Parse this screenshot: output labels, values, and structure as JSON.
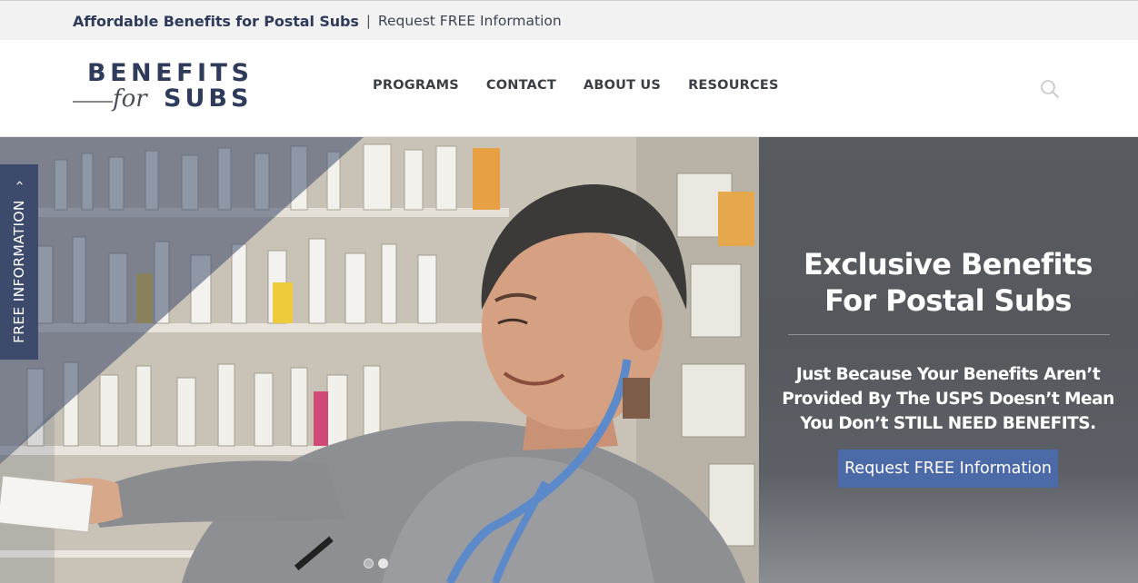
{
  "topbar": {
    "title": "Affordable Benefits for Postal Subs",
    "separator": "|",
    "link": "Request FREE Information"
  },
  "logo": {
    "top": "BENEFITS",
    "for": "for",
    "bottom": "SUBS"
  },
  "nav": {
    "items": [
      {
        "label": "PROGRAMS"
      },
      {
        "label": "CONTACT"
      },
      {
        "label": "ABOUT US"
      },
      {
        "label": "RESOURCES"
      }
    ],
    "search_icon": "search-icon"
  },
  "side_tab": {
    "label": "FREE INFORMATION",
    "arrow": "›"
  },
  "hero": {
    "title": "Exclusive Benefits For Postal Subs",
    "subtitle": "Just Because Your Benefits Aren’t Provided By The USPS Doesn’t Mean You Don’t STILL NEED BENEFITS.",
    "button": "Request FREE Information",
    "slides_total": 2,
    "slide_active": 2
  },
  "colors": {
    "navy": "#2f3b5a",
    "side_tab": "#3d4a6b",
    "button": "#4d6aa8",
    "panel": "#57595e"
  }
}
